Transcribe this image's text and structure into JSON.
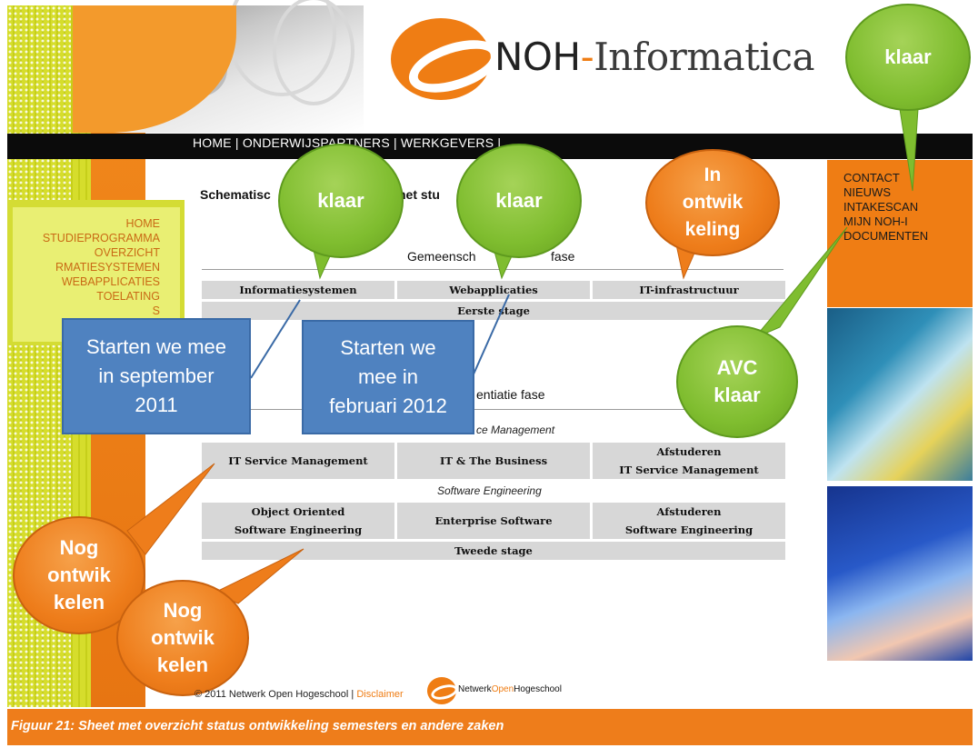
{
  "logo": {
    "brand": "NOH",
    "dash": "-",
    "name": "Informatica"
  },
  "nav": {
    "links": "HOME | ONDERWIJSPARTNERS | WERKGEVERS |"
  },
  "left_menu": {
    "items": [
      "HOME",
      "STUDIEPROGRAMMA",
      "OVERZICHT",
      "RMATIESYSTEMEN",
      "WEBAPPLICATIES",
      "TOELATING",
      "S",
      "STU"
    ]
  },
  "right_menu": {
    "items": [
      "CONTACT",
      "NIEUWS",
      "INTAKESCAN",
      "MIJN NOH-I",
      "DOCUMENTEN"
    ]
  },
  "main": {
    "heading_left": "Schematisc",
    "heading_right": "het stu",
    "phase1_left": "Gemeensch",
    "phase1_right": "fase",
    "phase1_cells": [
      "Informatiesystemen",
      "Webapplicaties",
      "IT-infrastructuur"
    ],
    "stage1": "Eerste stage",
    "phase2_title": "entiatie fase",
    "subsection1": "ce Management",
    "row1": [
      "IT Service Management",
      "IT & The Business",
      "Afstuderen",
      "IT Service Management"
    ],
    "subsection2": "Software Engineering",
    "row2": [
      "Object Oriented",
      "Software Engineering",
      "Enterprise Software",
      "Afstuderen",
      "Software Engineering"
    ],
    "stage2": "Tweede stage"
  },
  "callouts": {
    "klaar_top": "klaar",
    "klaar_1": "klaar",
    "klaar_2": "klaar",
    "in_ontwikkeling": [
      "In",
      "ontwik",
      "keling"
    ],
    "avc": [
      "AVC",
      "klaar"
    ],
    "nog1": [
      "Nog",
      "ontwik",
      "kelen"
    ],
    "nog2": [
      "Nog",
      "ontwik",
      "kelen"
    ],
    "sept": [
      "Starten we mee",
      "in september",
      "2011"
    ],
    "feb": [
      "Starten we",
      "mee in",
      "februari 2012"
    ]
  },
  "footer": {
    "copyright": "© 2011 Netwerk Open Hogeschool |",
    "disclaimer": "Disclaimer",
    "logo_a": "Netwerk",
    "logo_b": "Open",
    "logo_c": "Hogeschool"
  },
  "caption": "Figuur 21: Sheet met overzicht status ontwikkeling semesters en andere zaken",
  "colors": {
    "orange": "#ee7d1b",
    "green": "#7fbd2f",
    "blue": "#4f82c0",
    "nav": "#0b0b0b"
  }
}
